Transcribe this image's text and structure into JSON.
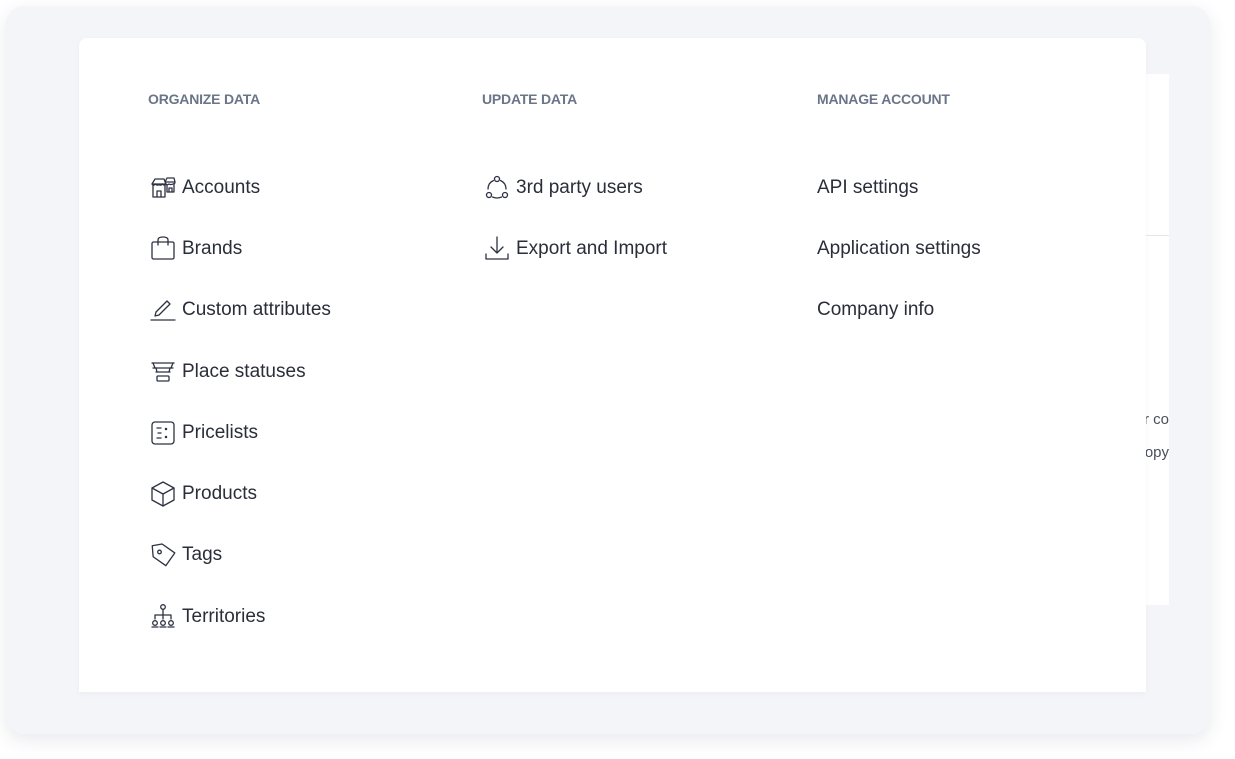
{
  "background_fragments": [
    "r co",
    "opy"
  ],
  "columns": [
    {
      "title": "ORGANIZE DATA",
      "items": [
        {
          "label": "Accounts",
          "icon": "store-icon"
        },
        {
          "label": "Brands",
          "icon": "shopping-bag-icon"
        },
        {
          "label": "Custom attributes",
          "icon": "pencil-icon"
        },
        {
          "label": "Place statuses",
          "icon": "funnel-icon"
        },
        {
          "label": "Pricelists",
          "icon": "pricelist-icon"
        },
        {
          "label": "Products",
          "icon": "box-icon"
        },
        {
          "label": "Tags",
          "icon": "tag-icon"
        },
        {
          "label": "Territories",
          "icon": "hierarchy-icon"
        }
      ]
    },
    {
      "title": "UPDATE DATA",
      "items": [
        {
          "label": "3rd party users",
          "icon": "users-network-icon"
        },
        {
          "label": "Export and Import",
          "icon": "download-icon"
        }
      ]
    },
    {
      "title": "MANAGE ACCOUNT",
      "items": [
        {
          "label": "API settings"
        },
        {
          "label": "Application settings"
        },
        {
          "label": "Company info"
        }
      ]
    }
  ]
}
